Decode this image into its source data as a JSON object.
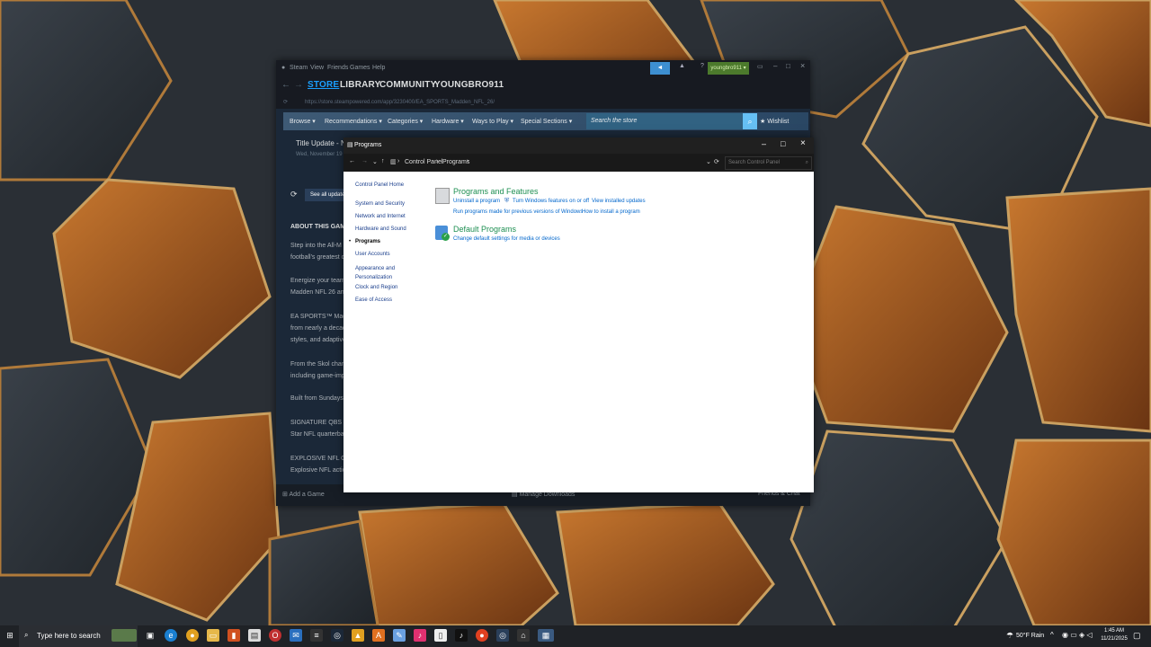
{
  "steam": {
    "menu": [
      "Steam",
      "View",
      "Friends",
      "Games",
      "Help"
    ],
    "account": "youngbro911",
    "nav": [
      "STORE",
      "LIBRARY",
      "COMMUNITY",
      "YOUNGBRO911"
    ],
    "url": "https://store.steampowered.com/app/3230400/EA_SPORTS_Madden_NFL_26/",
    "store_menu": [
      "Browse",
      "Recommendations",
      "Categories",
      "Hardware",
      "Ways to Play",
      "Special Sections"
    ],
    "search_placeholder": "Search the store",
    "wishlist": "Wishlist",
    "update_title": "Title Update - N",
    "update_date": "Wed, November 19",
    "see_all": "See all update",
    "about_heading": "ABOUT THIS GAM",
    "paragraphs": [
      "Step into the All-M",
      "football's greatest c",
      "Energize your team",
      "Madden NFL 26 an",
      "EA SPORTS™ Madd",
      "from nearly a decad",
      "styles, and adaptive",
      "From the Skol chan",
      "including game-imp",
      "Built from Sundays",
      "SIGNATURE QBS",
      "Star NFL quarterba",
      "EXPLOSIVE NFL GA",
      "Explosive NFL actio"
    ],
    "add_game": "Add a Game",
    "manage_downloads": "Manage Downloads",
    "friends_chat": "Friends & Chat"
  },
  "control_panel": {
    "title": "Programs",
    "breadcrumb": [
      "Control Panel",
      "Programs"
    ],
    "search_placeholder": "Search Control Panel",
    "sidebar": [
      "Control Panel Home",
      "System and Security",
      "Network and Internet",
      "Hardware and Sound",
      "Programs",
      "User Accounts",
      "Appearance and Personalization",
      "Clock and Region",
      "Ease of Access"
    ],
    "sections": [
      {
        "heading": "Programs and Features",
        "links": [
          "Uninstall a program",
          "Turn Windows features on or off",
          "View installed updates",
          "Run programs made for previous versions of Windows",
          "How to install a program"
        ]
      },
      {
        "heading": "Default Programs",
        "links": [
          "Change default settings for media or devices"
        ]
      }
    ]
  },
  "taskbar": {
    "search_placeholder": "Type here to search",
    "weather": "50°F Rain",
    "time": "1:45 AM",
    "date": "11/21/2025"
  }
}
